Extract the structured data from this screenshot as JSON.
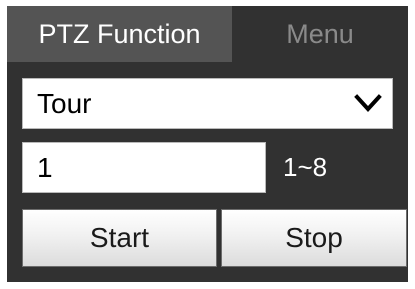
{
  "tabs": {
    "ptz_function": "PTZ Function",
    "menu": "Menu"
  },
  "function_select": {
    "value": "Tour",
    "icon": "chevron-down-icon"
  },
  "number_field": {
    "value": "1"
  },
  "range_label": "1~8",
  "buttons": {
    "start": "Start",
    "stop": "Stop"
  },
  "colors": {
    "panel_background": "#313131",
    "active_tab": "#545454",
    "inactive_tab_text": "#8a8a8a"
  }
}
